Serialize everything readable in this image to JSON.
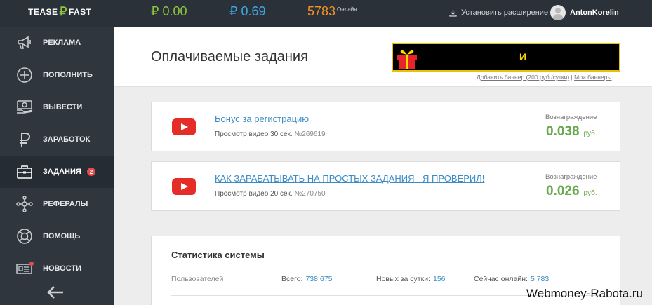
{
  "topbar": {
    "logo_left": "TEASE",
    "logo_symbol": "₽",
    "logo_right": "FAST",
    "balance_main": "₽ 0.00",
    "balance_ads": "₽ 0.69",
    "online_count": "5783",
    "online_label": "Онлайн",
    "extension_label": "Установить расширение",
    "username": "AntonKorelin"
  },
  "sidebar": {
    "items": [
      {
        "label": "РЕКЛАМА",
        "icon": "megaphone-icon"
      },
      {
        "label": "ПОПОЛНИТЬ",
        "icon": "plus-circle-icon"
      },
      {
        "label": "ВЫВЕСТИ",
        "icon": "cash-icon"
      },
      {
        "label": "ЗАРАБОТОК",
        "icon": "ruble-icon"
      },
      {
        "label": "ЗАДАНИЯ",
        "icon": "briefcase-icon",
        "badge": "2",
        "active": true
      },
      {
        "label": "РЕФЕРАЛЫ",
        "icon": "network-icon"
      },
      {
        "label": "ПОМОЩЬ",
        "icon": "lifebuoy-icon"
      },
      {
        "label": "НОВОСТИ",
        "icon": "newspaper-icon"
      }
    ]
  },
  "header": {
    "title": "Оплачиваемые задания",
    "banner_text": "И",
    "add_banner_link": "Добавить баннер (200 руб./сутки)",
    "separator": "|",
    "my_banners_link": "Мои баннеры"
  },
  "tasks": [
    {
      "title": "Бонус за регистрацию",
      "subtitle": "Просмотр видео 30 сек.",
      "number": "№269619",
      "reward_label": "Вознаграждение",
      "reward": "0.038",
      "currency": "руб."
    },
    {
      "title": "КАК ЗАРАБАТЫВАТЬ НА ПРОСТЫХ ЗАДАНИЯ - Я ПРОВЕРИЛ!",
      "subtitle": "Просмотр видео 20 сек.",
      "number": "№270750",
      "reward_label": "Вознаграждение",
      "reward": "0.026",
      "currency": "руб."
    }
  ],
  "stats": {
    "title": "Статистика системы",
    "row_label": "Пользователей",
    "total_label": "Всего:",
    "total_value": "738 675",
    "new_label": "Новых за сутки:",
    "new_value": "156",
    "online_label": "Сейчас онлайн:",
    "online_value": "5 783"
  },
  "watermark": "Webmoney-Rabota.ru",
  "colors": {
    "topbar_bg": "#2a3139",
    "sidebar_bg": "#2f363e",
    "green": "#8dc63f",
    "blue": "#3ea6e0",
    "orange": "#f39224",
    "link": "#3b8cc4",
    "reward": "#6aa84f",
    "youtube_red": "#e52d27"
  }
}
